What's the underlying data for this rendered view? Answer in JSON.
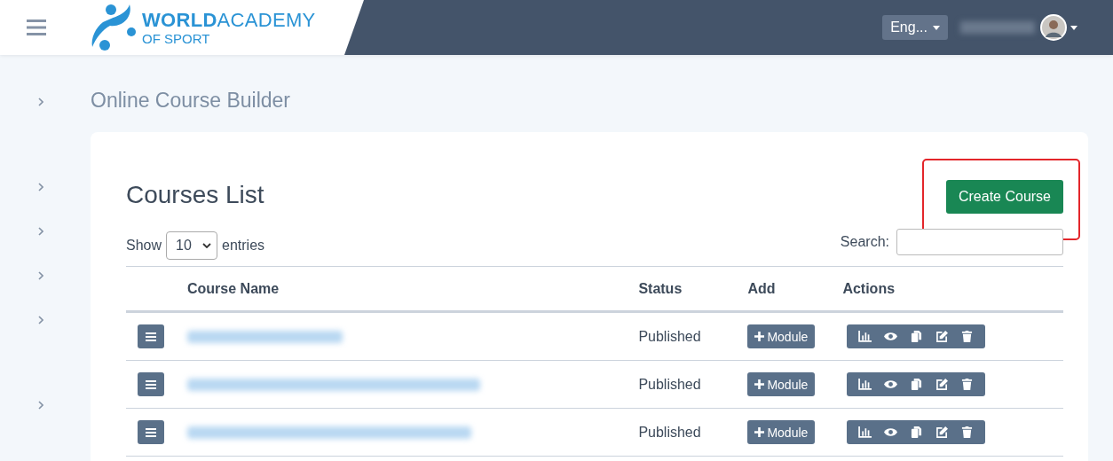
{
  "header": {
    "logo_text": "**WORLD**ACADEMY",
    "logo_subtext": "OF SPORT",
    "language": "Eng..."
  },
  "page_title": "Online Course Builder",
  "card": {
    "title": "Courses List",
    "create_button": "Create Course",
    "show_label": "Show",
    "entries_value": "10",
    "entries_label": "entries",
    "search_label": "Search:"
  },
  "table": {
    "columns": [
      "Course Name",
      "Status",
      "Add",
      "Actions"
    ],
    "rows": [
      {
        "status": "Published",
        "add_button": "Module"
      },
      {
        "status": "Published",
        "add_button": "Module"
      },
      {
        "status": "Published",
        "add_button": "Module"
      }
    ]
  }
}
